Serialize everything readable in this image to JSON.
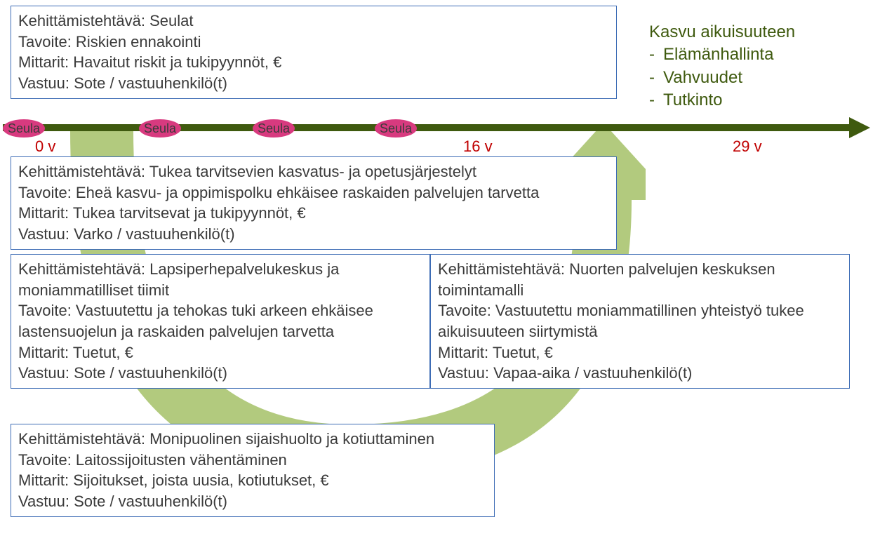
{
  "timeline": {
    "markers": [
      "Seula",
      "Seula",
      "Seula",
      "Seula"
    ],
    "ages": [
      "0 v",
      "16 v",
      "29 v"
    ]
  },
  "growth": {
    "title": "Kasvu aikuisuuteen",
    "items": [
      "Elämänhallinta",
      "Vahvuudet",
      "Tutkinto"
    ]
  },
  "boxes": {
    "top": {
      "l1": "Kehittämistehtävä: Seulat",
      "l2": "Tavoite: Riskien ennakointi",
      "l3": "Mittarit: Havaitut riskit ja tukipyynnöt, €",
      "l4": "Vastuu: Sote / vastuuhenkilö(t)"
    },
    "mid": {
      "l1": "Kehittämistehtävä: Tukea tarvitsevien kasvatus- ja opetusjärjestelyt",
      "l2": "Tavoite: Eheä kasvu- ja oppimispolku ehkäisee raskaiden palvelujen tarvetta",
      "l3": "Mittarit: Tukea tarvitsevat ja tukipyynnöt, €",
      "l4": "Vastuu: Varko / vastuuhenkilö(t)"
    },
    "bl": {
      "l1": "Kehittämistehtävä: Lapsiperhepalvelukeskus ja moniammatilliset tiimit",
      "l2": "Tavoite: Vastuutettu ja tehokas tuki arkeen ehkäisee lastensuojelun ja raskaiden palvelujen tarvetta",
      "l3": "Mittarit: Tuetut, €",
      "l4": "Vastuu: Sote / vastuuhenkilö(t)"
    },
    "br": {
      "l1": "Kehittämistehtävä: Nuorten palvelujen keskuksen toimintamalli",
      "l2": "Tavoite: Vastuutettu moniammatillinen yhteistyö tukee aikuisuuteen siirtymistä",
      "l3": "Mittarit: Tuetut, €",
      "l4": "Vastuu: Vapaa-aika / vastuuhenkilö(t)"
    },
    "bot": {
      "l1": "Kehittämistehtävä: Monipuolinen sijaishuolto ja kotiuttaminen",
      "l2": "Tavoite: Laitossijoitusten vähentäminen",
      "l3": "Mittarit: Sijoitukset, joista uusia, kotiutukset, €",
      "l4": "Vastuu: Sote / vastuuhenkilö(t)"
    }
  }
}
